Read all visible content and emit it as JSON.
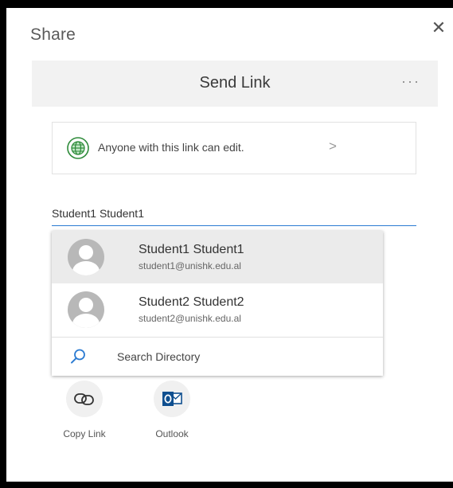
{
  "panel": {
    "title": "Share",
    "close_glyph": "✕"
  },
  "header": {
    "title": "Send Link",
    "more_glyph": "···"
  },
  "link_settings": {
    "text": "Anyone with this link can edit.",
    "chevron": ">",
    "icon": "globe-icon",
    "icon_color": "#2e8b3a"
  },
  "recipient": {
    "value": "Student1 Student1",
    "underline_color": "#2b7bd2"
  },
  "suggestions": [
    {
      "name": "Student1 Student1",
      "email": "student1@unishk.edu.al",
      "highlighted": true
    },
    {
      "name": "Student2 Student2",
      "email": "student2@unishk.edu.al",
      "highlighted": false
    }
  ],
  "search_directory": {
    "label": "Search Directory",
    "icon": "search-icon",
    "icon_color": "#2b7bd2"
  },
  "actions": [
    {
      "label": "Copy Link",
      "icon": "link-icon"
    },
    {
      "label": "Outlook",
      "icon": "outlook-icon",
      "icon_color": "#0f4f8f"
    }
  ]
}
